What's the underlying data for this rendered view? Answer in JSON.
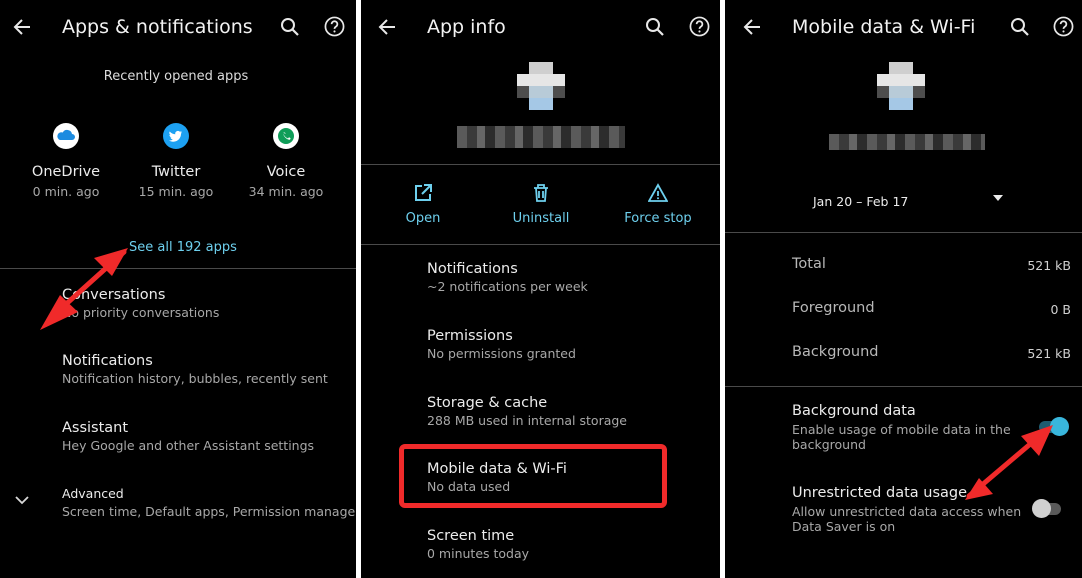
{
  "panel1": {
    "title": "Apps & notifications",
    "recent_header": "Recently opened apps",
    "recent_apps": [
      {
        "name": "OneDrive",
        "time": "0 min. ago"
      },
      {
        "name": "Twitter",
        "time": "15 min. ago"
      },
      {
        "name": "Voice",
        "time": "34 min. ago"
      }
    ],
    "see_all": "See all 192 apps",
    "items": [
      {
        "title": "Conversations",
        "subtitle": "No priority conversations"
      },
      {
        "title": "Notifications",
        "subtitle": "Notification history, bubbles, recently sent"
      },
      {
        "title": "Assistant",
        "subtitle": "Hey Google and other Assistant settings"
      },
      {
        "title": "Advanced",
        "subtitle": "Screen time, Default apps, Permission manage.."
      }
    ]
  },
  "panel2": {
    "title": "App info",
    "actions": [
      {
        "label": "Open",
        "icon": "open-external-icon"
      },
      {
        "label": "Uninstall",
        "icon": "trash-icon"
      },
      {
        "label": "Force stop",
        "icon": "warning-icon"
      }
    ],
    "items": [
      {
        "title": "Notifications",
        "subtitle": "~2 notifications per week"
      },
      {
        "title": "Permissions",
        "subtitle": "No permissions granted"
      },
      {
        "title": "Storage & cache",
        "subtitle": "288 MB used in internal storage"
      },
      {
        "title": "Mobile data & Wi-Fi",
        "subtitle": "No data used"
      },
      {
        "title": "Screen time",
        "subtitle": "0 minutes today"
      }
    ]
  },
  "panel3": {
    "title": "Mobile data & Wi-Fi",
    "date_range": "Jan 20 – Feb 17",
    "usage": [
      {
        "label": "Total",
        "value": "521 kB"
      },
      {
        "label": "Foreground",
        "value": "0 B"
      },
      {
        "label": "Background",
        "value": "521 kB"
      }
    ],
    "background_data": {
      "title": "Background data",
      "subtitle_line1": "Enable usage of mobile data in the",
      "subtitle_line2": "background",
      "enabled": true
    },
    "unrestricted": {
      "title": "Unrestricted data usage",
      "subtitle_line1": "Allow unrestricted data access when",
      "subtitle_line2": "Data Saver is on",
      "enabled": false
    }
  },
  "colors": {
    "accent": "#6ed0ee",
    "annotation_red": "#f02a2a",
    "background": "#000000",
    "toggle_on_thumb": "#39b6dc",
    "toggle_off_thumb": "#d0d0d0"
  }
}
